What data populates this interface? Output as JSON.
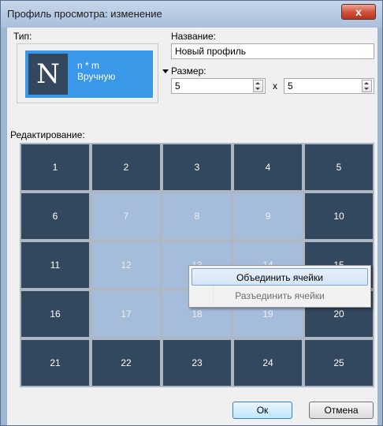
{
  "window": {
    "title": "Профиль просмотра: изменение",
    "close_label": "x"
  },
  "type_section": {
    "label": "Тип:",
    "icon_letter": "N",
    "line1": "n * m",
    "line2": "Вручную"
  },
  "name_section": {
    "label": "Название:",
    "value": "Новый профиль"
  },
  "size_section": {
    "label": "Размер:",
    "rows": "5",
    "times": "x",
    "cols": "5"
  },
  "edit_section": {
    "label": "Редактирование:"
  },
  "grid": {
    "cells": [
      "1",
      "2",
      "3",
      "4",
      "5",
      "6",
      "7",
      "8",
      "9",
      "10",
      "11",
      "12",
      "13",
      "14",
      "15",
      "16",
      "17",
      "18",
      "19",
      "20",
      "21",
      "22",
      "23",
      "24",
      "25"
    ],
    "selected": [
      7,
      8,
      9,
      12,
      13,
      14,
      17,
      18,
      19
    ]
  },
  "context_menu": {
    "merge": "Объединить ячейки",
    "split": "Разъединить ячейки"
  },
  "buttons": {
    "ok": "Ок",
    "cancel": "Отмена"
  },
  "colors": {
    "cell_dark": "#33475e",
    "cell_selected": "#a6bcdb",
    "accent": "#3a98e8"
  }
}
